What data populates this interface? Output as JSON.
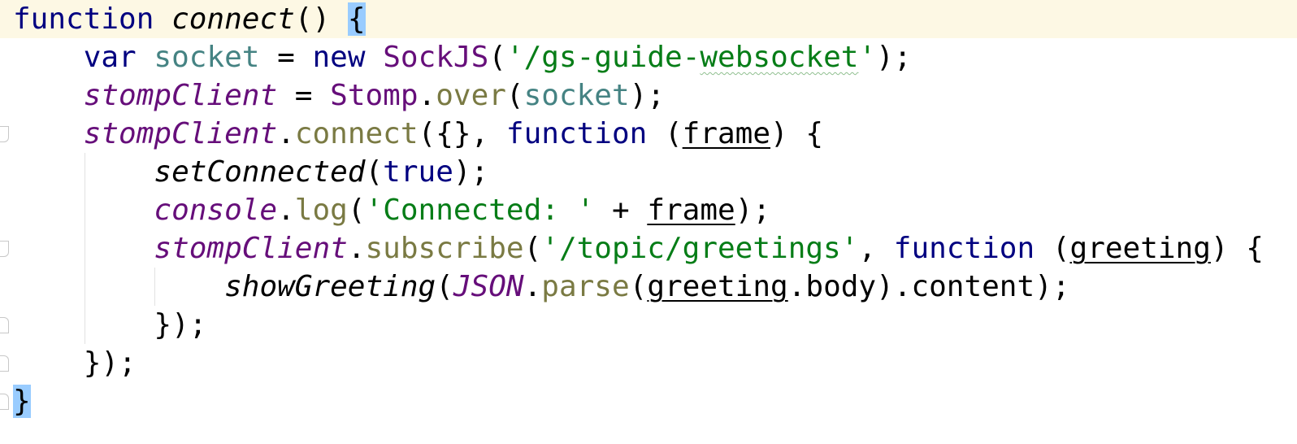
{
  "editor": {
    "language": "JavaScript",
    "colors": {
      "keyword": "#000080",
      "string": "#067d17",
      "global": "#660e7a",
      "local": "#458383",
      "method": "#7a7a43",
      "current_line": "#fdf8e4",
      "brace_match": "#99ccff"
    },
    "lines": [
      {
        "n": 1,
        "tokens": [
          {
            "t": "kw",
            "v": "function"
          },
          {
            "t": "plain",
            "v": " "
          },
          {
            "t": "fn-decl",
            "v": "connect"
          },
          {
            "t": "plain",
            "v": "() "
          },
          {
            "t": "brace-match",
            "v": "{"
          }
        ]
      },
      {
        "n": 2,
        "tokens": [
          {
            "t": "plain",
            "v": "    "
          },
          {
            "t": "kw",
            "v": "var"
          },
          {
            "t": "plain",
            "v": " "
          },
          {
            "t": "local",
            "v": "socket"
          },
          {
            "t": "plain",
            "v": " = "
          },
          {
            "t": "kw",
            "v": "new"
          },
          {
            "t": "plain",
            "v": " "
          },
          {
            "t": "class",
            "v": "SockJS"
          },
          {
            "t": "plain",
            "v": "("
          },
          {
            "t": "str",
            "v": "'/gs-guide-"
          },
          {
            "t": "str-typo",
            "v": "websocket"
          },
          {
            "t": "str",
            "v": "'"
          },
          {
            "t": "plain",
            "v": ");"
          }
        ]
      },
      {
        "n": 3,
        "tokens": [
          {
            "t": "plain",
            "v": "    "
          },
          {
            "t": "global",
            "v": "stompClient"
          },
          {
            "t": "plain",
            "v": " = "
          },
          {
            "t": "class",
            "v": "Stomp"
          },
          {
            "t": "plain",
            "v": "."
          },
          {
            "t": "method",
            "v": "over"
          },
          {
            "t": "plain",
            "v": "("
          },
          {
            "t": "local",
            "v": "socket"
          },
          {
            "t": "plain",
            "v": ");"
          }
        ]
      },
      {
        "n": 4,
        "tokens": [
          {
            "t": "plain",
            "v": "    "
          },
          {
            "t": "global",
            "v": "stompClient"
          },
          {
            "t": "plain",
            "v": "."
          },
          {
            "t": "method",
            "v": "connect"
          },
          {
            "t": "plain",
            "v": "({}, "
          },
          {
            "t": "kw",
            "v": "function"
          },
          {
            "t": "plain",
            "v": " ("
          },
          {
            "t": "param",
            "v": "frame"
          },
          {
            "t": "plain",
            "v": ") {"
          }
        ]
      },
      {
        "n": 5,
        "tokens": [
          {
            "t": "plain",
            "v": "        "
          },
          {
            "t": "call",
            "v": "setConnected"
          },
          {
            "t": "plain",
            "v": "("
          },
          {
            "t": "kw",
            "v": "true"
          },
          {
            "t": "plain",
            "v": ");"
          }
        ]
      },
      {
        "n": 6,
        "tokens": [
          {
            "t": "plain",
            "v": "        "
          },
          {
            "t": "global",
            "v": "console"
          },
          {
            "t": "plain",
            "v": "."
          },
          {
            "t": "method",
            "v": "log"
          },
          {
            "t": "plain",
            "v": "("
          },
          {
            "t": "str",
            "v": "'Connected: '"
          },
          {
            "t": "plain",
            "v": " + "
          },
          {
            "t": "param",
            "v": "frame"
          },
          {
            "t": "plain",
            "v": ");"
          }
        ]
      },
      {
        "n": 7,
        "tokens": [
          {
            "t": "plain",
            "v": "        "
          },
          {
            "t": "global",
            "v": "stompClient"
          },
          {
            "t": "plain",
            "v": "."
          },
          {
            "t": "method",
            "v": "subscribe"
          },
          {
            "t": "plain",
            "v": "("
          },
          {
            "t": "str",
            "v": "'/topic/greetings'"
          },
          {
            "t": "plain",
            "v": ", "
          },
          {
            "t": "kw",
            "v": "function"
          },
          {
            "t": "plain",
            "v": " ("
          },
          {
            "t": "param",
            "v": "greeting"
          },
          {
            "t": "plain",
            "v": ") {"
          }
        ]
      },
      {
        "n": 8,
        "tokens": [
          {
            "t": "plain",
            "v": "            "
          },
          {
            "t": "call",
            "v": "showGreeting"
          },
          {
            "t": "plain",
            "v": "("
          },
          {
            "t": "global",
            "v": "JSON"
          },
          {
            "t": "plain",
            "v": "."
          },
          {
            "t": "method",
            "v": "parse"
          },
          {
            "t": "plain",
            "v": "("
          },
          {
            "t": "param",
            "v": "greeting"
          },
          {
            "t": "plain",
            "v": ".body).content);"
          }
        ]
      },
      {
        "n": 9,
        "tokens": [
          {
            "t": "plain",
            "v": "        });"
          }
        ]
      },
      {
        "n": 10,
        "tokens": [
          {
            "t": "plain",
            "v": "    });"
          }
        ]
      },
      {
        "n": 11,
        "tokens": [
          {
            "t": "brace-match",
            "v": "}"
          }
        ]
      }
    ]
  }
}
